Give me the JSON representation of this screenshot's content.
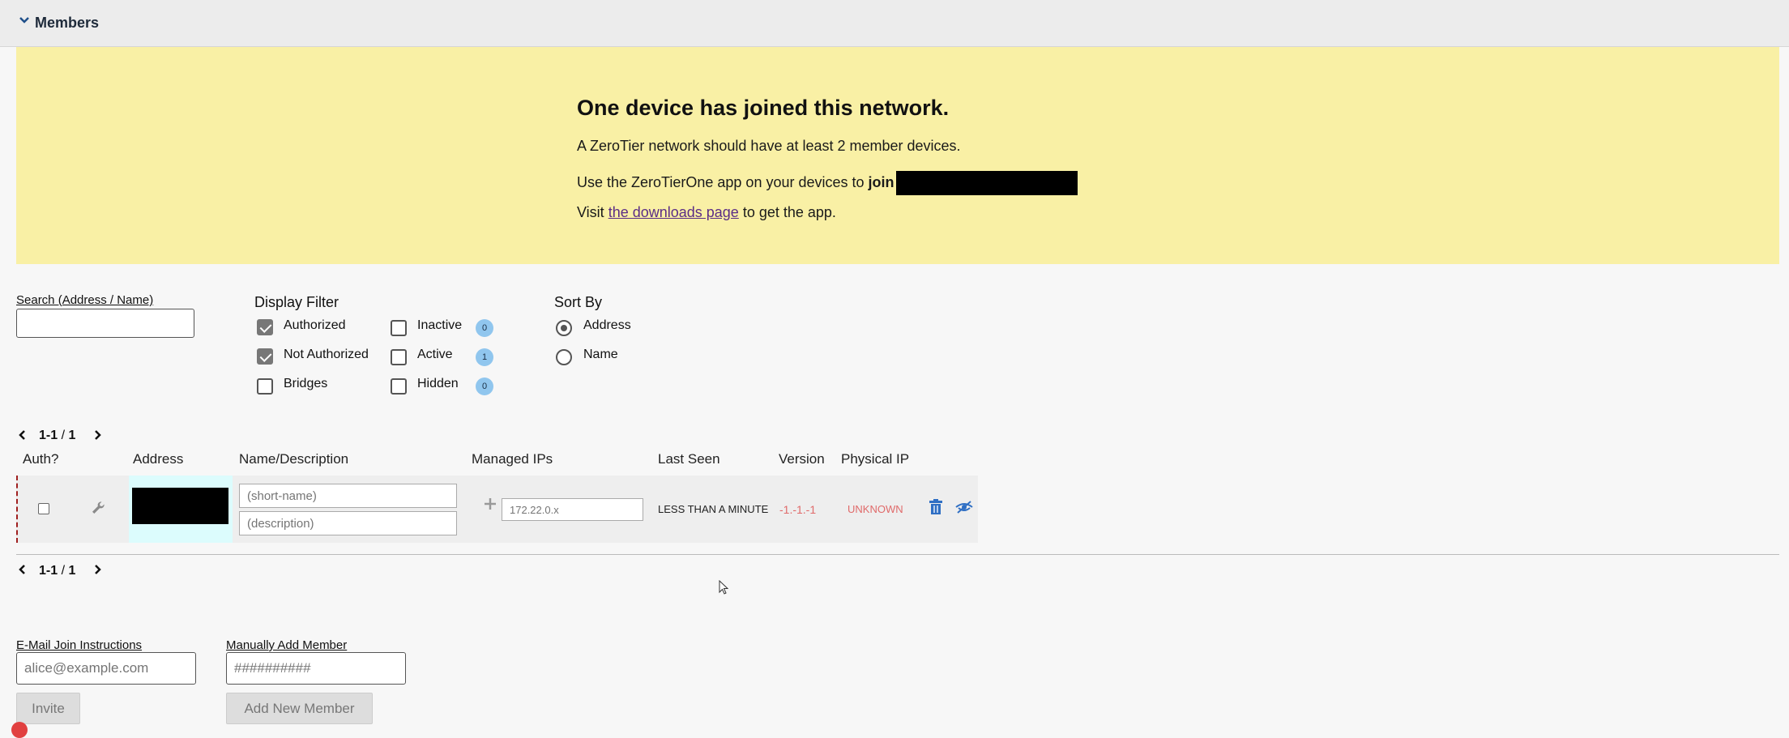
{
  "section": {
    "title": "Members",
    "icon": "chevron-down-icon"
  },
  "notice": {
    "title": "One device has joined this network.",
    "line1": "A ZeroTier network should have at least 2 member devices.",
    "line2_prefix": "Use the ZeroTierOne app on your devices to ",
    "line2_bold": "join",
    "line3_prefix": "Visit ",
    "line3_link": "the downloads page",
    "line3_suffix": " to get the app."
  },
  "search": {
    "label": "Search (Address / Name)",
    "value": "",
    "placeholder": ""
  },
  "display_filter": {
    "label": "Display Filter",
    "options": [
      {
        "label": "Authorized",
        "checked": true
      },
      {
        "label": "Not Authorized",
        "checked": true
      },
      {
        "label": "Bridges",
        "checked": false
      },
      {
        "label": "Inactive",
        "checked": false,
        "count": "0"
      },
      {
        "label": "Active",
        "checked": false,
        "count": "1"
      },
      {
        "label": "Hidden",
        "checked": false,
        "count": "0"
      }
    ]
  },
  "sort_by": {
    "label": "Sort By",
    "options": [
      {
        "label": "Address",
        "selected": true
      },
      {
        "label": "Name",
        "selected": false
      }
    ]
  },
  "pager": {
    "range": "1-1",
    "separator": " / ",
    "total": "1"
  },
  "table": {
    "headers": {
      "auth": "Auth?",
      "address": "Address",
      "name": "Name/Description",
      "ips": "Managed IPs",
      "last_seen": "Last Seen",
      "version": "Version",
      "physical_ip": "Physical IP"
    },
    "rows": [
      {
        "authorized": false,
        "short_name_placeholder": "(short-name)",
        "description_placeholder": "(description)",
        "ip_placeholder": "172.22.0.x",
        "last_seen": "LESS THAN A MINUTE",
        "version": "-1.-1.-1",
        "physical_ip": "UNKNOWN"
      }
    ]
  },
  "email_invite": {
    "label": "E-Mail Join Instructions",
    "placeholder": "alice@example.com",
    "button": "Invite"
  },
  "manual_add": {
    "label": "Manually Add Member",
    "placeholder": "##########",
    "button": "Add New Member"
  },
  "colors": {
    "notice_bg": "#f9f0a5",
    "badge": "#90c6ee",
    "error_text": "#e06a6a",
    "icon_blue": "#2f6fc4"
  }
}
